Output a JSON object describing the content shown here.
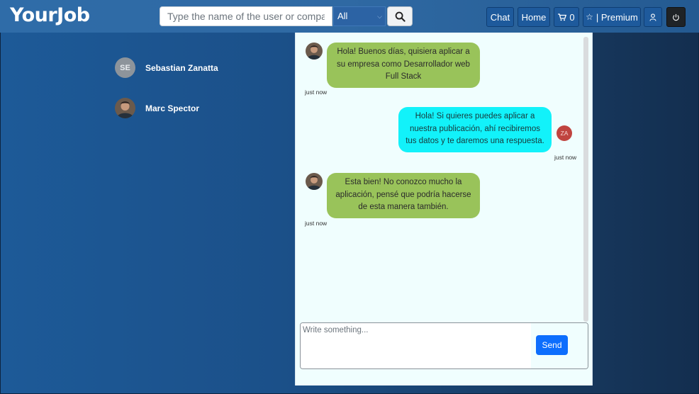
{
  "brand": {
    "name": "YourJob"
  },
  "search": {
    "placeholder": "Type the name of the user or company",
    "filter_selected": "All"
  },
  "nav": {
    "chat": "Chat",
    "home": "Home",
    "cart_count": "0",
    "premium": "| Premium"
  },
  "contacts": [
    {
      "initials": "SE",
      "name": "Sebastian Zanatta"
    },
    {
      "name": "Marc Spector"
    }
  ],
  "messages": [
    {
      "text": "Hola! Buenos días, quisiera aplicar a su empresa como Desarrollador web Full Stack",
      "time": "just now",
      "side": "left"
    },
    {
      "text": "Hola! Si quieres puedes aplicar a nuestra publicación, ahí recibiremos tus datos y te daremos una respuesta.",
      "time": "just now",
      "side": "right",
      "initials": "ZA"
    },
    {
      "text": "Esta bien! No conozco mucho la aplicación, pensé que podría hacerse de esta manera también.",
      "time": "just now",
      "side": "left"
    }
  ],
  "composer": {
    "placeholder": "Write something...",
    "send_label": "Send"
  },
  "colors": {
    "incoming_bubble": "#99c35a",
    "outgoing_bubble": "#12f2fa",
    "send_button": "#0d6efd",
    "chat_background": "#f0fefe"
  }
}
